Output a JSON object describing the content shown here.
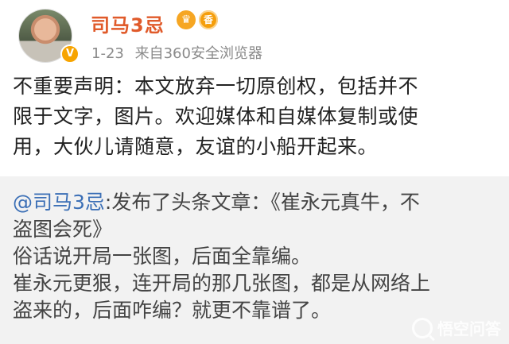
{
  "header": {
    "username": "司马3忌",
    "crown_badge": "crown-icon",
    "flower_badge_label": "香",
    "verified_mark": "V",
    "date": "1-23",
    "source": "来自360安全浏览器"
  },
  "post": {
    "text": "不重要声明：本文放弃一切原创权，包括并不\n限于文字，图片。欢迎媒体和自媒体复制或使\n用，大伙儿请随意，友谊的小船开起来。"
  },
  "quote": {
    "mention": "@司马3忌",
    "lead": ":发布了头条文章：《崔永元真牛，不\n盗图会死》",
    "body": "俗话说开局一张图，后面全靠编。\n崔永元更狠，连开局的那几张图，都是从网络上\n盗来的，后面咋编？就更不靠谱了。"
  },
  "watermark": {
    "text": "悟空问答"
  },
  "colors": {
    "username": "#e05a2a",
    "mention": "#3b6fb6",
    "quote_bg": "#f2f2f2",
    "meta": "#8a8a8a"
  }
}
